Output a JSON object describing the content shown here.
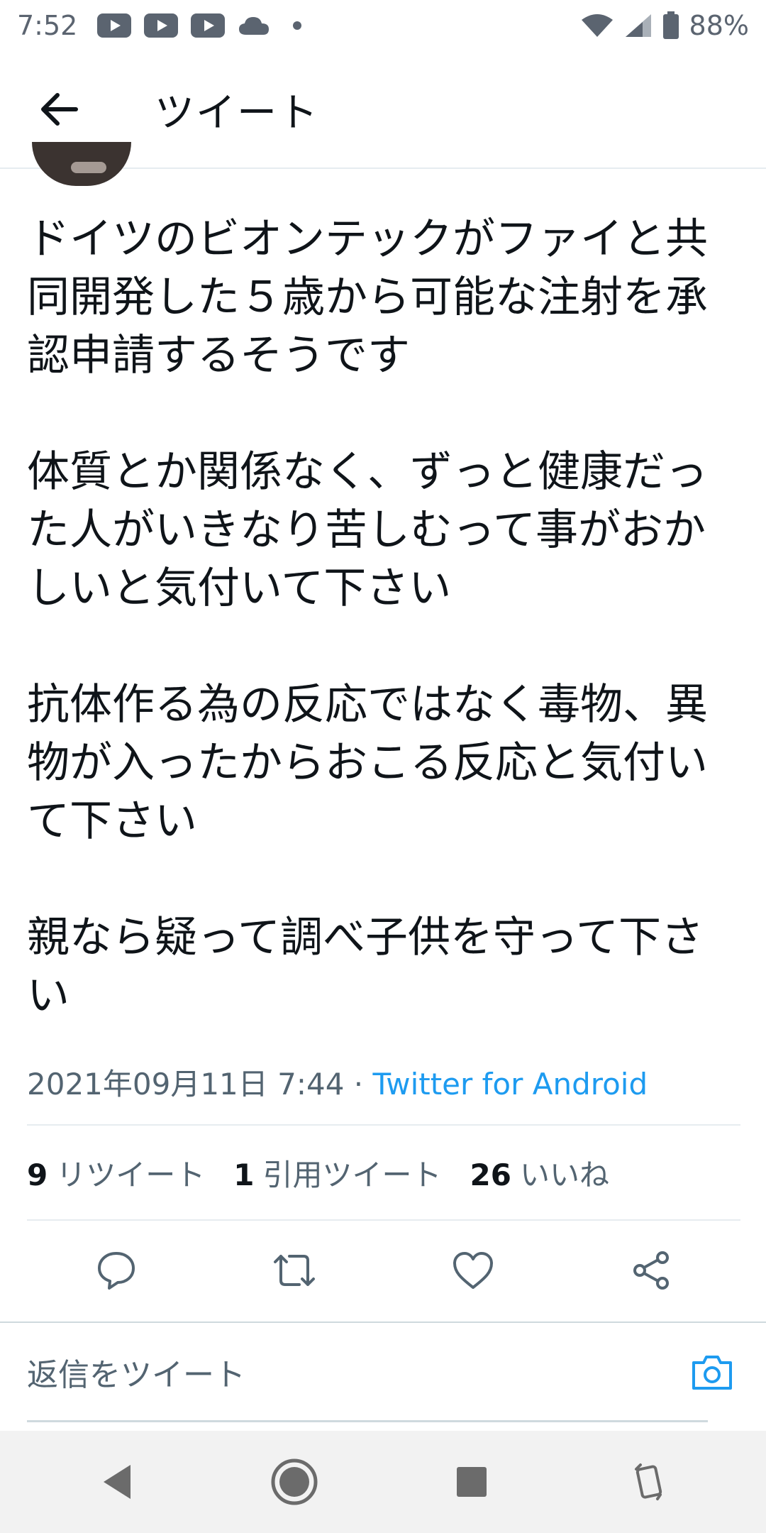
{
  "status_bar": {
    "time": "7:52",
    "battery": "88%",
    "icons": [
      "youtube-icon",
      "youtube-icon",
      "youtube-icon",
      "cloud-icon",
      "dot-icon",
      "wifi-icon",
      "signal-icon",
      "battery-icon"
    ]
  },
  "app_bar": {
    "title": "ツイート"
  },
  "tweet": {
    "paragraphs": [
      "ドイツのビオンテックがファイと共同開発した５歳から可能な注射を承認申請するそうです",
      "体質とか関係なく、ずっと健康だった人がいきなり苦しむって事がおかしいと気付いて下さい",
      "抗体作る為の反応ではなく毒物、異物が入ったからおこる反応と気付いて下さい",
      "親なら疑って調べ子供を守って下さい"
    ],
    "datetime": "2021年09月11日 7:44",
    "separator": " · ",
    "source": "Twitter for Android"
  },
  "stats": {
    "retweets_count": "9",
    "retweets_label": "リツイート",
    "quotes_count": "1",
    "quotes_label": "引用ツイート",
    "likes_count": "26",
    "likes_label": "いいね"
  },
  "reply": {
    "placeholder": "返信をツイート"
  },
  "colors": {
    "accent": "#1d9bf0",
    "text": "#0f1419",
    "muted": "#536471"
  }
}
